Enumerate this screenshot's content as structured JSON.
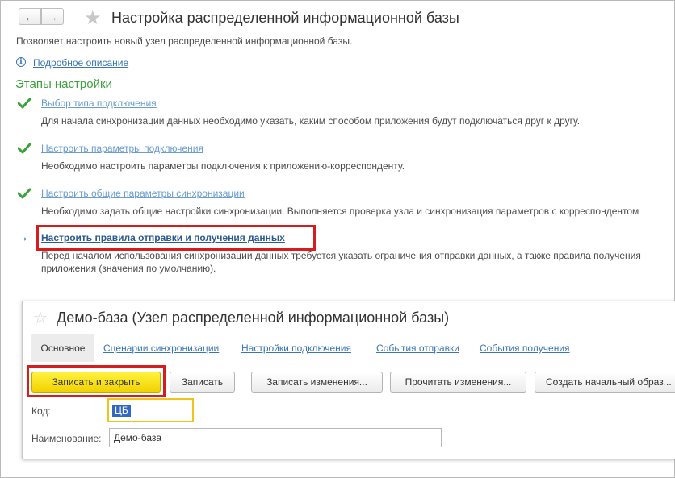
{
  "window": {
    "title": "Настройка распределенной информационной базы",
    "subtitle": "Позволяет настроить новый узел распределенной информационной базы.",
    "details_link": "Подробное описание",
    "nav": {
      "back_icon": "arrow-left-icon",
      "forward_icon": "arrow-right-icon",
      "favorite_icon": "star-icon"
    }
  },
  "steps": {
    "heading": "Этапы настройки",
    "items": [
      {
        "label": "Выбор типа подключения",
        "description": "Для начала синхронизации данных необходимо указать, каким способом приложения будут подключаться друг к другу.",
        "state": "done"
      },
      {
        "label": "Настроить параметры подключения",
        "description": "Необходимо настроить параметры подключения к приложению-корреспонденту.",
        "state": "done"
      },
      {
        "label": "Настроить общие параметры синхронизации",
        "description": "Необходимо задать общие настройки синхронизации. Выполняется проверка узла и синхронизация параметров с корреспондентом",
        "state": "done"
      },
      {
        "label": "Настроить правила отправки и получения данных",
        "description_line1": "Перед началом использования синхронизации данных требуется указать ограничения отправки данных, а также правила получения",
        "description_line2": "приложения (значения по умолчанию).",
        "state": "current"
      }
    ]
  },
  "form": {
    "title": "Демо-база (Узел распределенной информационной базы)",
    "tabs": [
      "Основное",
      "Сценарии синхронизации",
      "Настройки подключения",
      "События отправки",
      "События получения"
    ],
    "buttons": {
      "save_close": "Записать и закрыть",
      "save": "Записать",
      "write_changes": "Записать изменения...",
      "read_changes": "Прочитать изменения...",
      "create_image": "Создать начальный образ..."
    },
    "fields": {
      "code_label": "Код:",
      "code_value": "ЦБ",
      "name_label": "Наименование:",
      "name_value": "Демо-база"
    }
  },
  "colors": {
    "link": "#3a76b5",
    "heading_green": "#3aa23a",
    "highlight_red": "#d61d1d",
    "primary_button": "#f5dc19",
    "focus_yellow": "#f0c419"
  }
}
